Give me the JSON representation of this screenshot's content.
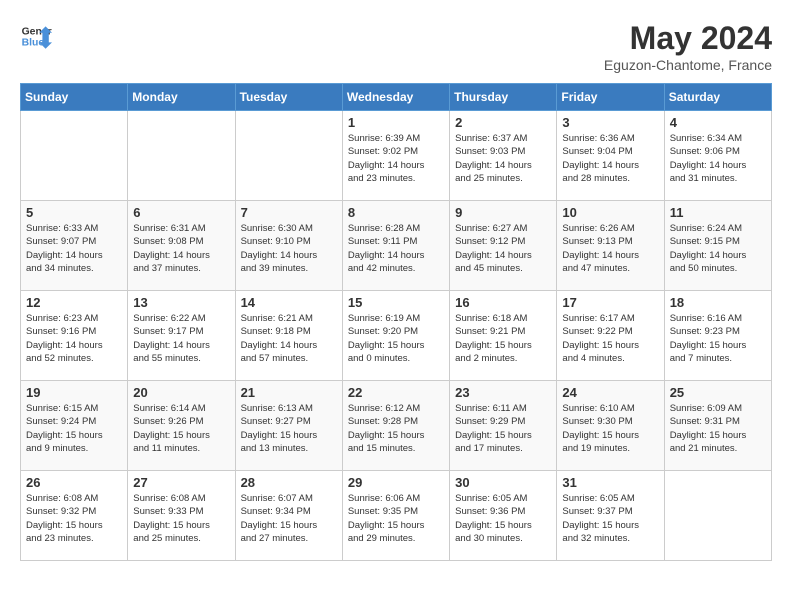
{
  "header": {
    "logo_line1": "General",
    "logo_line2": "Blue",
    "month_title": "May 2024",
    "subtitle": "Eguzon-Chantome, France"
  },
  "weekdays": [
    "Sunday",
    "Monday",
    "Tuesday",
    "Wednesday",
    "Thursday",
    "Friday",
    "Saturday"
  ],
  "weeks": [
    [
      {
        "day": "",
        "info": ""
      },
      {
        "day": "",
        "info": ""
      },
      {
        "day": "",
        "info": ""
      },
      {
        "day": "1",
        "info": "Sunrise: 6:39 AM\nSunset: 9:02 PM\nDaylight: 14 hours\nand 23 minutes."
      },
      {
        "day": "2",
        "info": "Sunrise: 6:37 AM\nSunset: 9:03 PM\nDaylight: 14 hours\nand 25 minutes."
      },
      {
        "day": "3",
        "info": "Sunrise: 6:36 AM\nSunset: 9:04 PM\nDaylight: 14 hours\nand 28 minutes."
      },
      {
        "day": "4",
        "info": "Sunrise: 6:34 AM\nSunset: 9:06 PM\nDaylight: 14 hours\nand 31 minutes."
      }
    ],
    [
      {
        "day": "5",
        "info": "Sunrise: 6:33 AM\nSunset: 9:07 PM\nDaylight: 14 hours\nand 34 minutes."
      },
      {
        "day": "6",
        "info": "Sunrise: 6:31 AM\nSunset: 9:08 PM\nDaylight: 14 hours\nand 37 minutes."
      },
      {
        "day": "7",
        "info": "Sunrise: 6:30 AM\nSunset: 9:10 PM\nDaylight: 14 hours\nand 39 minutes."
      },
      {
        "day": "8",
        "info": "Sunrise: 6:28 AM\nSunset: 9:11 PM\nDaylight: 14 hours\nand 42 minutes."
      },
      {
        "day": "9",
        "info": "Sunrise: 6:27 AM\nSunset: 9:12 PM\nDaylight: 14 hours\nand 45 minutes."
      },
      {
        "day": "10",
        "info": "Sunrise: 6:26 AM\nSunset: 9:13 PM\nDaylight: 14 hours\nand 47 minutes."
      },
      {
        "day": "11",
        "info": "Sunrise: 6:24 AM\nSunset: 9:15 PM\nDaylight: 14 hours\nand 50 minutes."
      }
    ],
    [
      {
        "day": "12",
        "info": "Sunrise: 6:23 AM\nSunset: 9:16 PM\nDaylight: 14 hours\nand 52 minutes."
      },
      {
        "day": "13",
        "info": "Sunrise: 6:22 AM\nSunset: 9:17 PM\nDaylight: 14 hours\nand 55 minutes."
      },
      {
        "day": "14",
        "info": "Sunrise: 6:21 AM\nSunset: 9:18 PM\nDaylight: 14 hours\nand 57 minutes."
      },
      {
        "day": "15",
        "info": "Sunrise: 6:19 AM\nSunset: 9:20 PM\nDaylight: 15 hours\nand 0 minutes."
      },
      {
        "day": "16",
        "info": "Sunrise: 6:18 AM\nSunset: 9:21 PM\nDaylight: 15 hours\nand 2 minutes."
      },
      {
        "day": "17",
        "info": "Sunrise: 6:17 AM\nSunset: 9:22 PM\nDaylight: 15 hours\nand 4 minutes."
      },
      {
        "day": "18",
        "info": "Sunrise: 6:16 AM\nSunset: 9:23 PM\nDaylight: 15 hours\nand 7 minutes."
      }
    ],
    [
      {
        "day": "19",
        "info": "Sunrise: 6:15 AM\nSunset: 9:24 PM\nDaylight: 15 hours\nand 9 minutes."
      },
      {
        "day": "20",
        "info": "Sunrise: 6:14 AM\nSunset: 9:26 PM\nDaylight: 15 hours\nand 11 minutes."
      },
      {
        "day": "21",
        "info": "Sunrise: 6:13 AM\nSunset: 9:27 PM\nDaylight: 15 hours\nand 13 minutes."
      },
      {
        "day": "22",
        "info": "Sunrise: 6:12 AM\nSunset: 9:28 PM\nDaylight: 15 hours\nand 15 minutes."
      },
      {
        "day": "23",
        "info": "Sunrise: 6:11 AM\nSunset: 9:29 PM\nDaylight: 15 hours\nand 17 minutes."
      },
      {
        "day": "24",
        "info": "Sunrise: 6:10 AM\nSunset: 9:30 PM\nDaylight: 15 hours\nand 19 minutes."
      },
      {
        "day": "25",
        "info": "Sunrise: 6:09 AM\nSunset: 9:31 PM\nDaylight: 15 hours\nand 21 minutes."
      }
    ],
    [
      {
        "day": "26",
        "info": "Sunrise: 6:08 AM\nSunset: 9:32 PM\nDaylight: 15 hours\nand 23 minutes."
      },
      {
        "day": "27",
        "info": "Sunrise: 6:08 AM\nSunset: 9:33 PM\nDaylight: 15 hours\nand 25 minutes."
      },
      {
        "day": "28",
        "info": "Sunrise: 6:07 AM\nSunset: 9:34 PM\nDaylight: 15 hours\nand 27 minutes."
      },
      {
        "day": "29",
        "info": "Sunrise: 6:06 AM\nSunset: 9:35 PM\nDaylight: 15 hours\nand 29 minutes."
      },
      {
        "day": "30",
        "info": "Sunrise: 6:05 AM\nSunset: 9:36 PM\nDaylight: 15 hours\nand 30 minutes."
      },
      {
        "day": "31",
        "info": "Sunrise: 6:05 AM\nSunset: 9:37 PM\nDaylight: 15 hours\nand 32 minutes."
      },
      {
        "day": "",
        "info": ""
      }
    ]
  ]
}
